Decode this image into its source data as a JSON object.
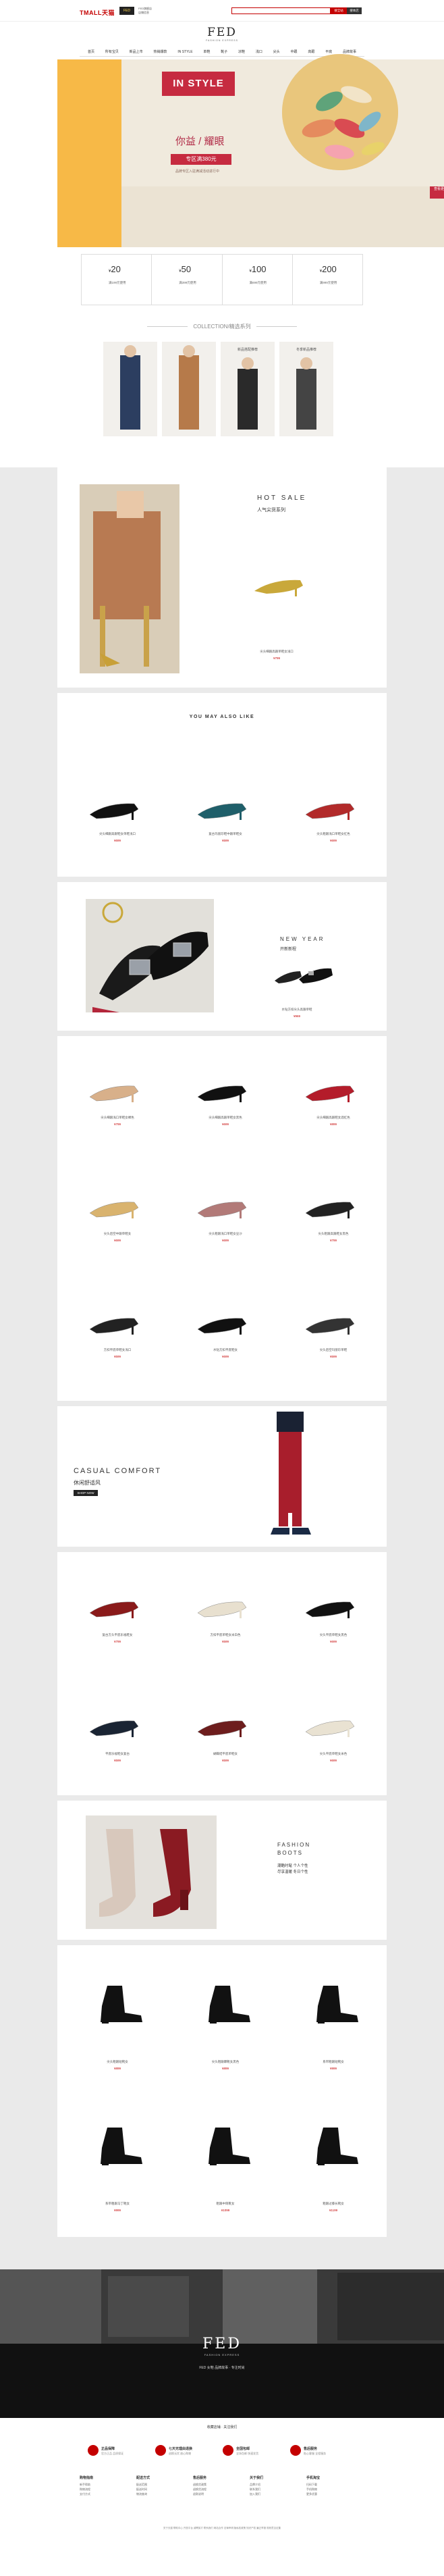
{
  "header": {
    "tmall": "TMALL天猫",
    "brand": "FED",
    "brand_sub": "FASHION EXPRESS",
    "search_btn": "搜全站",
    "search_btn2": "搜本店",
    "nav": [
      "首页",
      "所有宝贝",
      "新品上市",
      "热销爆款",
      "IN STYLE",
      "单鞋",
      "靴子",
      "凉鞋",
      "浅口",
      "尖头",
      "中跟",
      "高跟",
      "平底",
      "品牌故事"
    ]
  },
  "hero": {
    "tag": "IN STYLE",
    "title": "你益 / 耀眼",
    "badge": "专区满380元",
    "sub": "品牌专区入驻满减活动进行中",
    "button": "查看更多"
  },
  "coupons": [
    {
      "symbol": "¥",
      "amount": "20",
      "label": "满199元使用"
    },
    {
      "symbol": "¥",
      "amount": "50",
      "label": "满399元使用"
    },
    {
      "symbol": "¥",
      "amount": "100",
      "label": "满699元使用"
    },
    {
      "symbol": "¥",
      "amount": "200",
      "label": "满999元使用"
    }
  ],
  "collection": {
    "title": "COLLECTION/精选系列",
    "items": [
      {
        "label": "",
        "color": "#2c3e60"
      },
      {
        "label": "",
        "color": "#b67a4a"
      },
      {
        "label": "新品搭配推荐",
        "color": "#2a2a2a"
      },
      {
        "label": "冬季新品推荐",
        "color": "#444"
      }
    ]
  },
  "hotsale": {
    "title": "HOT SALE",
    "sub": "人气尖货系列",
    "product": {
      "name": "尖头细跟高跟单鞋女浅口",
      "price": "¥799"
    }
  },
  "like": {
    "title": "YOU MAY ALSO LIKE",
    "items": [
      {
        "name": "尖头细跟高跟鞋女单鞋浅口",
        "price": "¥699",
        "color": "#111"
      },
      {
        "name": "复古玛丽珍鞋中跟单鞋女",
        "price": "¥599",
        "color": "#1f5f6a"
      },
      {
        "name": "尖头粗跟浅口单鞋女红色",
        "price": "¥699",
        "color": "#b22a2a"
      }
    ]
  },
  "newyear": {
    "title": "NEW YEAR",
    "sub": "开新新程",
    "product": {
      "name": "水钻方扣尖头高跟单鞋",
      "price": "¥969"
    }
  },
  "grid1": [
    {
      "name": "尖头细跟浅口单鞋女裸色",
      "price": "¥799",
      "color": "#d8b08a"
    },
    {
      "name": "尖头细跟高跟单鞋女黑色",
      "price": "¥699",
      "color": "#111"
    },
    {
      "name": "尖头细跟高跟鞋女酒红色",
      "price": "¥899",
      "color": "#b41c2a"
    },
    {
      "name": "尖头后空中跟单鞋女",
      "price": "¥699",
      "color": "#d9b36e"
    },
    {
      "name": "尖头粗跟浅口单鞋女豆沙",
      "price": "¥699",
      "color": "#b27a78"
    },
    {
      "name": "尖头粗跟高跟鞋女黑色",
      "price": "¥799",
      "color": "#222"
    },
    {
      "name": "方扣平底单鞋女浅口",
      "price": "¥599",
      "color": "#222"
    },
    {
      "name": "水钻方扣平底鞋女",
      "price": "¥699",
      "color": "#111"
    },
    {
      "name": "尖头后空玛丽珍单鞋",
      "price": "¥599",
      "color": "#333"
    }
  ],
  "casual": {
    "title": "CASUAL COMFORT",
    "sub": "休闲舒适风",
    "button": "SHOP NOW"
  },
  "grid2": [
    {
      "name": "复古方头平底乐福鞋女",
      "price": "¥799",
      "color": "#8a1a1a"
    },
    {
      "name": "方扣平底单鞋女米白色",
      "price": "¥599",
      "color": "#e8e0cf"
    },
    {
      "name": "尖头平底单鞋女黑色",
      "price": "¥699",
      "color": "#111"
    },
    {
      "name": "平底乐福鞋女复古",
      "price": "¥599",
      "color": "#1a2433"
    },
    {
      "name": "蝴蝶结平底单鞋女",
      "price": "¥599",
      "color": "#6d1d1d"
    },
    {
      "name": "尖头平底单鞋女米色",
      "price": "¥699",
      "color": "#e9e2d2"
    }
  ],
  "fashion": {
    "title": "FASHION BOOTS",
    "sub": "潮酷时髦 个人个性",
    "sub2": "尽享温暖 冬日个性"
  },
  "grid3": [
    {
      "name": "尖头粗跟短靴女",
      "price": "¥899",
      "color": "#111"
    },
    {
      "name": "尖头粗跟踝靴女黑色",
      "price": "¥899",
      "color": "#111"
    },
    {
      "name": "系带粗跟短靴女",
      "price": "¥999",
      "color": "#111"
    },
    {
      "name": "系带粗跟马丁靴女",
      "price": "¥999",
      "color": "#111"
    },
    {
      "name": "粗跟中筒靴女",
      "price": "¥1099",
      "color": "#111"
    },
    {
      "name": "粗跟过膝长靴女",
      "price": "¥1199",
      "color": "#111"
    }
  ],
  "footer": {
    "brand": "FED",
    "sub": "FASHION EXPRESS",
    "text": "FED 女鞋 品牌故事 · 专注时尚",
    "bar": "收藏店铺 · 关注我们",
    "services": [
      {
        "t": "正品保障",
        "s": "官方正品 品质保证"
      },
      {
        "t": "七天无理由退换",
        "s": "退换无忧 放心购物"
      },
      {
        "t": "全国包邮",
        "s": "全场包邮 快速发货"
      },
      {
        "t": "售后服务",
        "s": "贴心客服 全程服务"
      }
    ],
    "cols": [
      {
        "title": "购物指南",
        "lines": [
          "新手帮助",
          "购物流程",
          "支付方式"
        ]
      },
      {
        "title": "配送方式",
        "lines": [
          "配送范围",
          "配送时间",
          "物流查询"
        ]
      },
      {
        "title": "售后服务",
        "lines": [
          "退换货政策",
          "退换货流程",
          "退款说明"
        ]
      },
      {
        "title": "关于我们",
        "lines": [
          "品牌介绍",
          "联系我们",
          "加入我们"
        ]
      },
      {
        "title": "手机淘宝",
        "lines": [
          "扫码下载",
          "手机购物",
          "更多优惠"
        ]
      }
    ],
    "links": "关于天猫 帮助中心 开放平台 诚聘英才 联系我们 网站合作 法律声明 隐私权政策 知识产权 廉正举报 规则意见征集"
  },
  "colors": {
    "accent": "#c62b40",
    "yellow": "#f7b947",
    "grey": "#eaeaea"
  }
}
